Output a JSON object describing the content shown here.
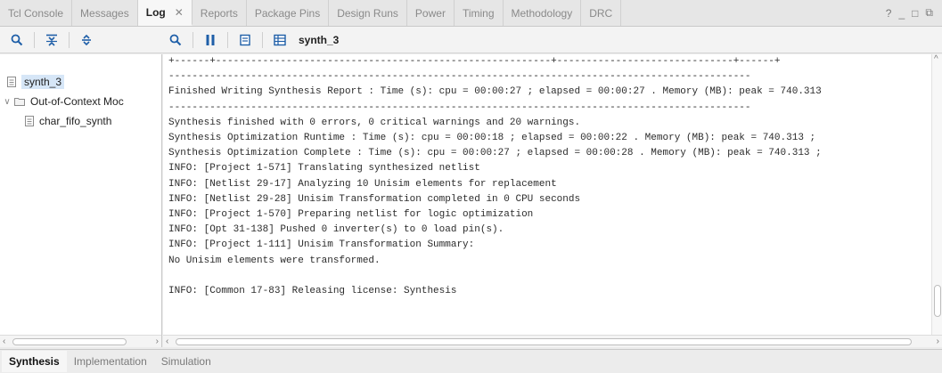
{
  "tabs": [
    {
      "label": "Tcl Console",
      "active": false
    },
    {
      "label": "Messages",
      "active": false
    },
    {
      "label": "Log",
      "active": true
    },
    {
      "label": "Reports",
      "active": false
    },
    {
      "label": "Package Pins",
      "active": false
    },
    {
      "label": "Design Runs",
      "active": false
    },
    {
      "label": "Power",
      "active": false
    },
    {
      "label": "Timing",
      "active": false
    },
    {
      "label": "Methodology",
      "active": false
    },
    {
      "label": "DRC",
      "active": false
    }
  ],
  "window_controls": {
    "help": "?",
    "minimize": "_",
    "restore": "□",
    "float": "⧉"
  },
  "toolbar": {
    "title": "synth_3"
  },
  "tree": {
    "items": [
      {
        "label": "synth_3",
        "level": 0,
        "selected": true,
        "expandable": false,
        "icon": "file-icon"
      },
      {
        "label": "Out-of-Context Moc",
        "level": 0,
        "selected": false,
        "expandable": true,
        "icon": "folder-icon"
      },
      {
        "label": "char_fifo_synth",
        "level": 1,
        "selected": false,
        "expandable": false,
        "icon": "file-icon"
      }
    ]
  },
  "log": {
    "lines": [
      "+------+---------------------------------------------------------+------------------------------+------+",
      "---------------------------------------------------------------------------------------------------",
      "Finished Writing Synthesis Report : Time (s): cpu = 00:00:27 ; elapsed = 00:00:27 . Memory (MB): peak = 740.313",
      "---------------------------------------------------------------------------------------------------",
      "Synthesis finished with 0 errors, 0 critical warnings and 20 warnings.",
      "Synthesis Optimization Runtime : Time (s): cpu = 00:00:18 ; elapsed = 00:00:22 . Memory (MB): peak = 740.313 ;",
      "Synthesis Optimization Complete : Time (s): cpu = 00:00:27 ; elapsed = 00:00:28 . Memory (MB): peak = 740.313 ;",
      "INFO: [Project 1-571] Translating synthesized netlist",
      "INFO: [Netlist 29-17] Analyzing 10 Unisim elements for replacement",
      "INFO: [Netlist 29-28] Unisim Transformation completed in 0 CPU seconds",
      "INFO: [Project 1-570] Preparing netlist for logic optimization",
      "INFO: [Opt 31-138] Pushed 0 inverter(s) to 0 load pin(s).",
      "INFO: [Project 1-111] Unisim Transformation Summary:",
      "No Unisim elements were transformed.",
      "",
      "INFO: [Common 17-83] Releasing license: Synthesis"
    ]
  },
  "bottom_tabs": [
    {
      "label": "Synthesis",
      "active": true
    },
    {
      "label": "Implementation",
      "active": false
    },
    {
      "label": "Simulation",
      "active": false
    }
  ],
  "colors": {
    "accent": "#1f5fa8",
    "selection": "#d6e6f7"
  }
}
